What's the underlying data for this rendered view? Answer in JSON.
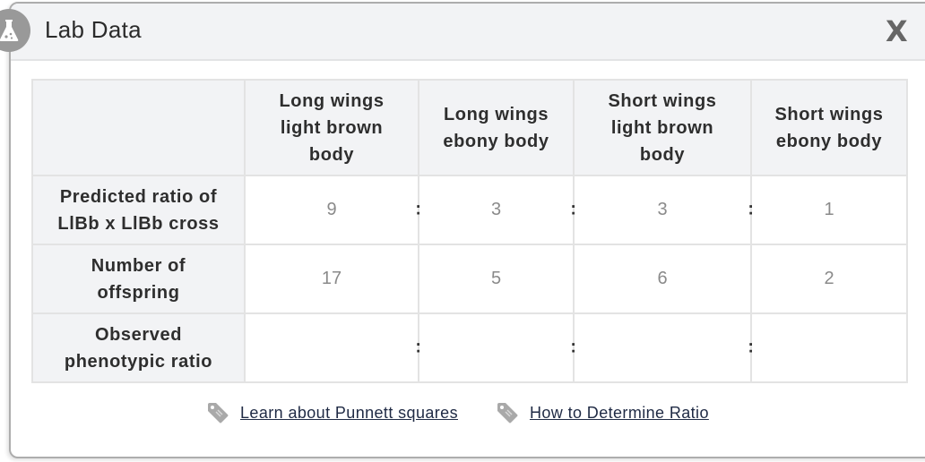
{
  "dialog": {
    "title": "Lab Data",
    "close_label": "X",
    "icon": "flask-icon"
  },
  "table": {
    "columns": [
      "Long wings light brown body",
      "Long wings ebony body",
      "Short wings light brown body",
      "Short wings ebony body"
    ],
    "column_lines": [
      [
        "Long wings",
        "light brown",
        "body"
      ],
      [
        "Long wings",
        "ebony body"
      ],
      [
        "Short wings",
        "light brown",
        "body"
      ],
      [
        "Short wings",
        "ebony body"
      ]
    ],
    "rows": [
      {
        "label_lines": [
          "Predicted ratio of",
          "LlBb x LlBb cross"
        ],
        "values": [
          "9",
          "3",
          "3",
          "1"
        ],
        "separator": ":"
      },
      {
        "label_lines": [
          "Number of",
          "offspring"
        ],
        "values": [
          "17",
          "5",
          "6",
          "2"
        ]
      },
      {
        "label_lines": [
          "Observed",
          "phenotypic ratio"
        ],
        "values": [
          "",
          "",
          "",
          ""
        ],
        "separator": ":"
      }
    ]
  },
  "links": [
    {
      "label": "Learn about Punnett squares",
      "icon": "tag-icon"
    },
    {
      "label": "How to Determine Ratio",
      "icon": "tag-icon"
    }
  ],
  "colors": {
    "header_bg": "#f2f3f5",
    "border": "#e3e3e3",
    "badge": "#999999",
    "link": "#1f2a44"
  }
}
